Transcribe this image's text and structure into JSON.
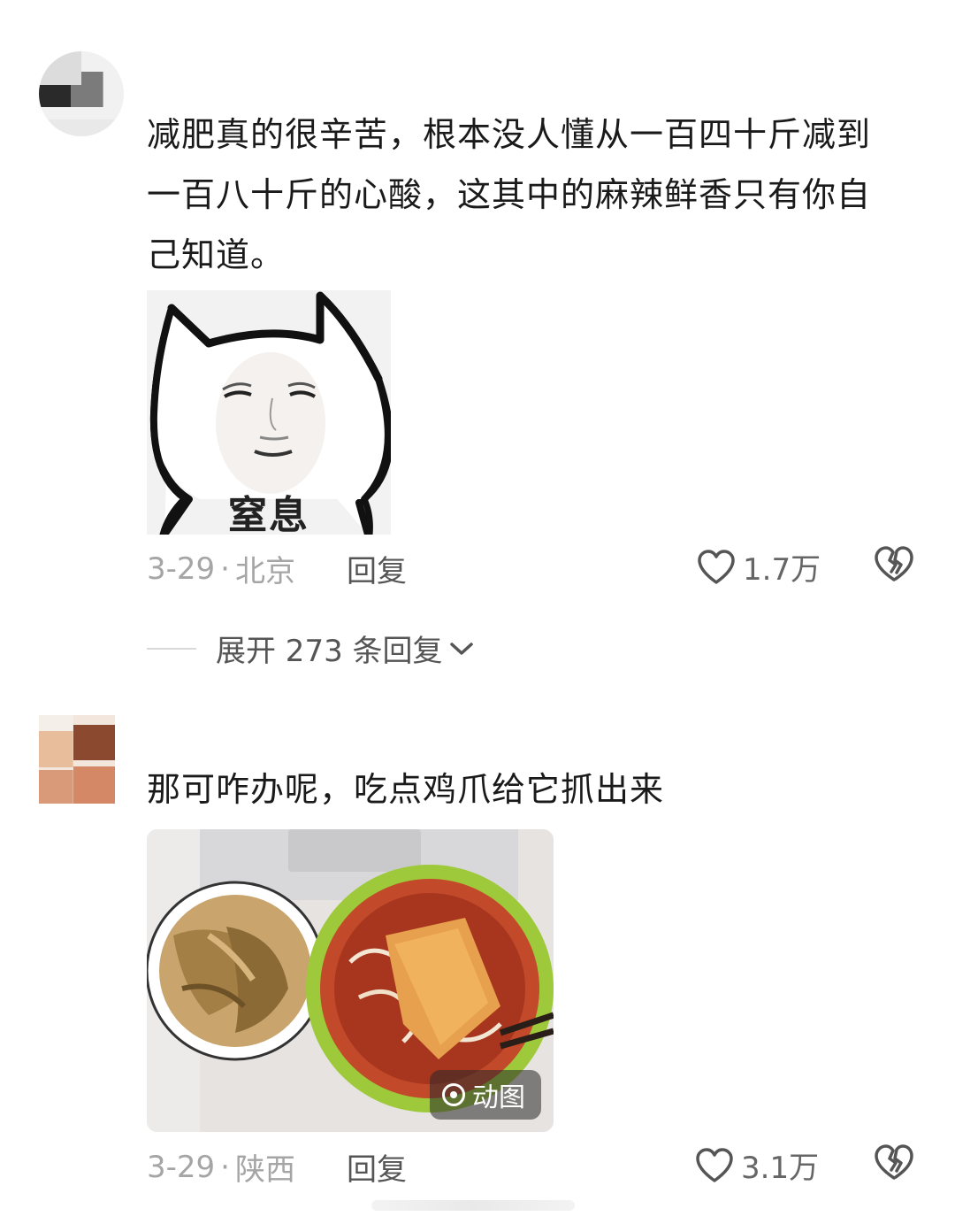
{
  "comments": [
    {
      "text_line1": "减肥真的很辛苦，根本没人懂从一百四十斤减到",
      "text_line2": "一百八十斤的心酸，这其中的麻辣鲜香只有你自",
      "text_line3": "己知道。",
      "image_caption": "窒息",
      "date": "3-29",
      "location": "北京",
      "reply_label": "回复",
      "likes": "1.7万"
    },
    {
      "text_line1": "那可咋办呢，吃点鸡爪给它抓出来",
      "gif_badge": "动图",
      "date": "3-29",
      "location": "陕西",
      "reply_label": "回复",
      "likes": "3.1万"
    }
  ],
  "expand_replies": {
    "label": "展开 273 条回复"
  }
}
